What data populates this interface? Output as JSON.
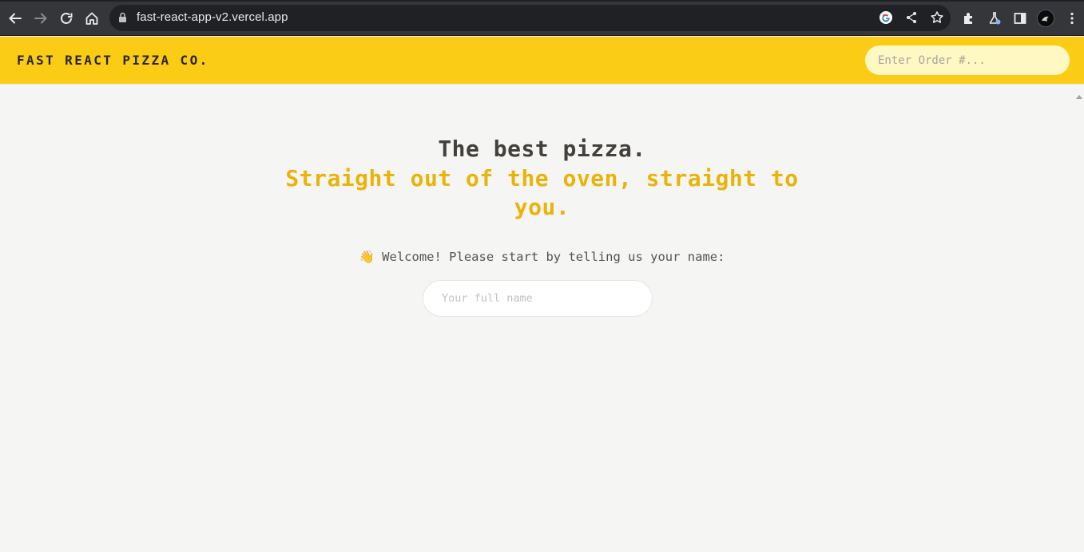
{
  "browser": {
    "url": "fast-react-app-v2.vercel.app",
    "nav_icons": [
      "back-icon",
      "forward-icon",
      "reload-icon",
      "home-icon"
    ],
    "omnibox_icons": [
      "google-icon",
      "share-icon",
      "bookmark-star-icon"
    ],
    "toolbar_icons": [
      "extensions-icon",
      "labs-icon",
      "side-panel-icon",
      "profile-avatar",
      "menu-icon"
    ]
  },
  "header": {
    "brand": "FAST REACT PIZZA CO.",
    "order_search_placeholder": "Enter Order #..."
  },
  "hero": {
    "title": "The best pizza.",
    "subtitle": "Straight out of the oven, straight to you."
  },
  "welcome": {
    "message": "👋 Welcome! Please start by telling us your name:",
    "name_placeholder": "Your full name"
  },
  "colors": {
    "brand_yellow": "#facc15",
    "accent_yellow": "#eab308",
    "search_bg": "#fef9c3",
    "page_bg": "#f5f5f4",
    "text_dark": "#292524"
  }
}
